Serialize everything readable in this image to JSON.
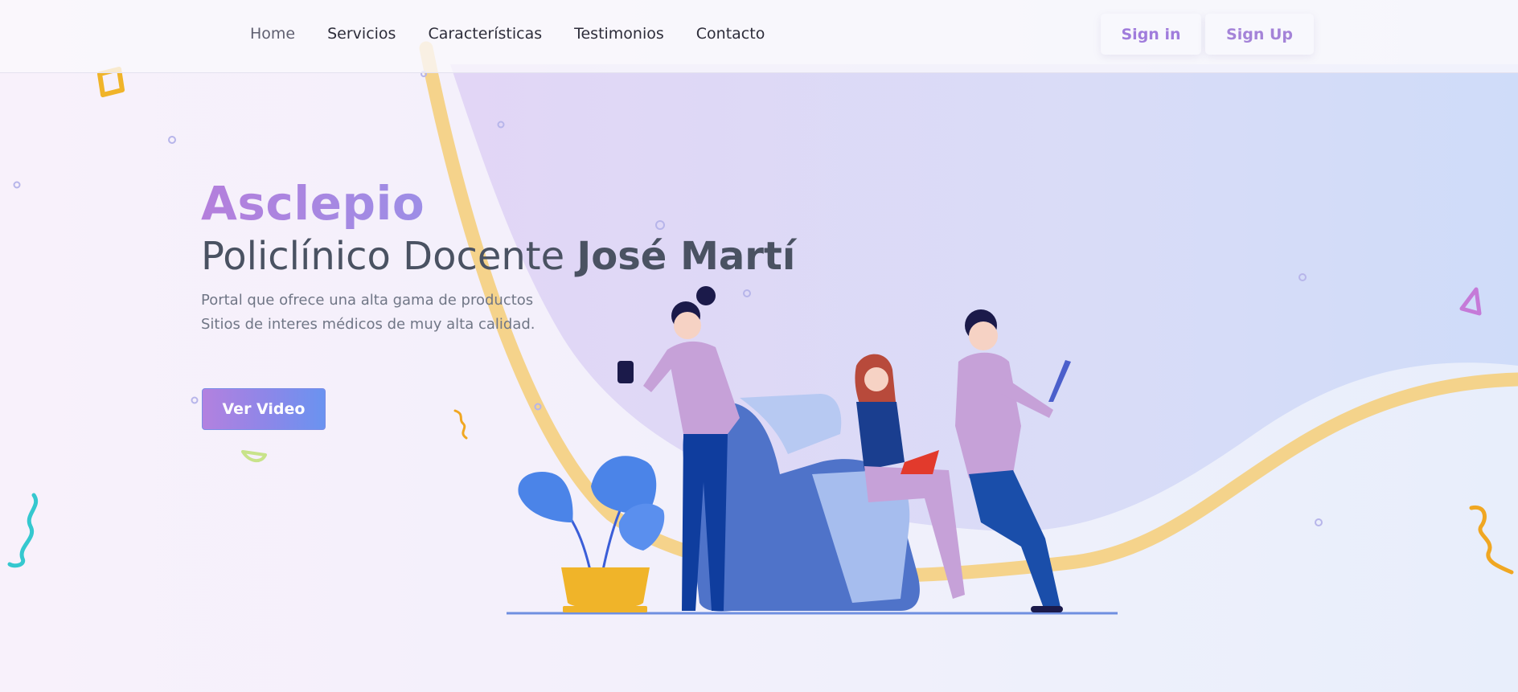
{
  "nav": {
    "links": [
      {
        "label": "Home"
      },
      {
        "label": "Servicios"
      },
      {
        "label": "Características"
      },
      {
        "label": "Testimonios"
      },
      {
        "label": "Contacto"
      }
    ],
    "signin_label": "Sign in",
    "signup_label": "Sign Up"
  },
  "hero": {
    "title": "Asclepio",
    "subtitle_regular": "Policlínico Docente ",
    "subtitle_bold": "José Martí",
    "desc_line1": "Portal que ofrece una alta gama de productos",
    "desc_line2": "Sitios de interes médicos de muy alta calidad.",
    "cta_label": "Ver Video"
  },
  "colors": {
    "accent_purple": "#b47fdc",
    "accent_blue": "#6a93f0",
    "wave_yellow": "#f5cf7e",
    "text_dark": "#4a5262"
  }
}
